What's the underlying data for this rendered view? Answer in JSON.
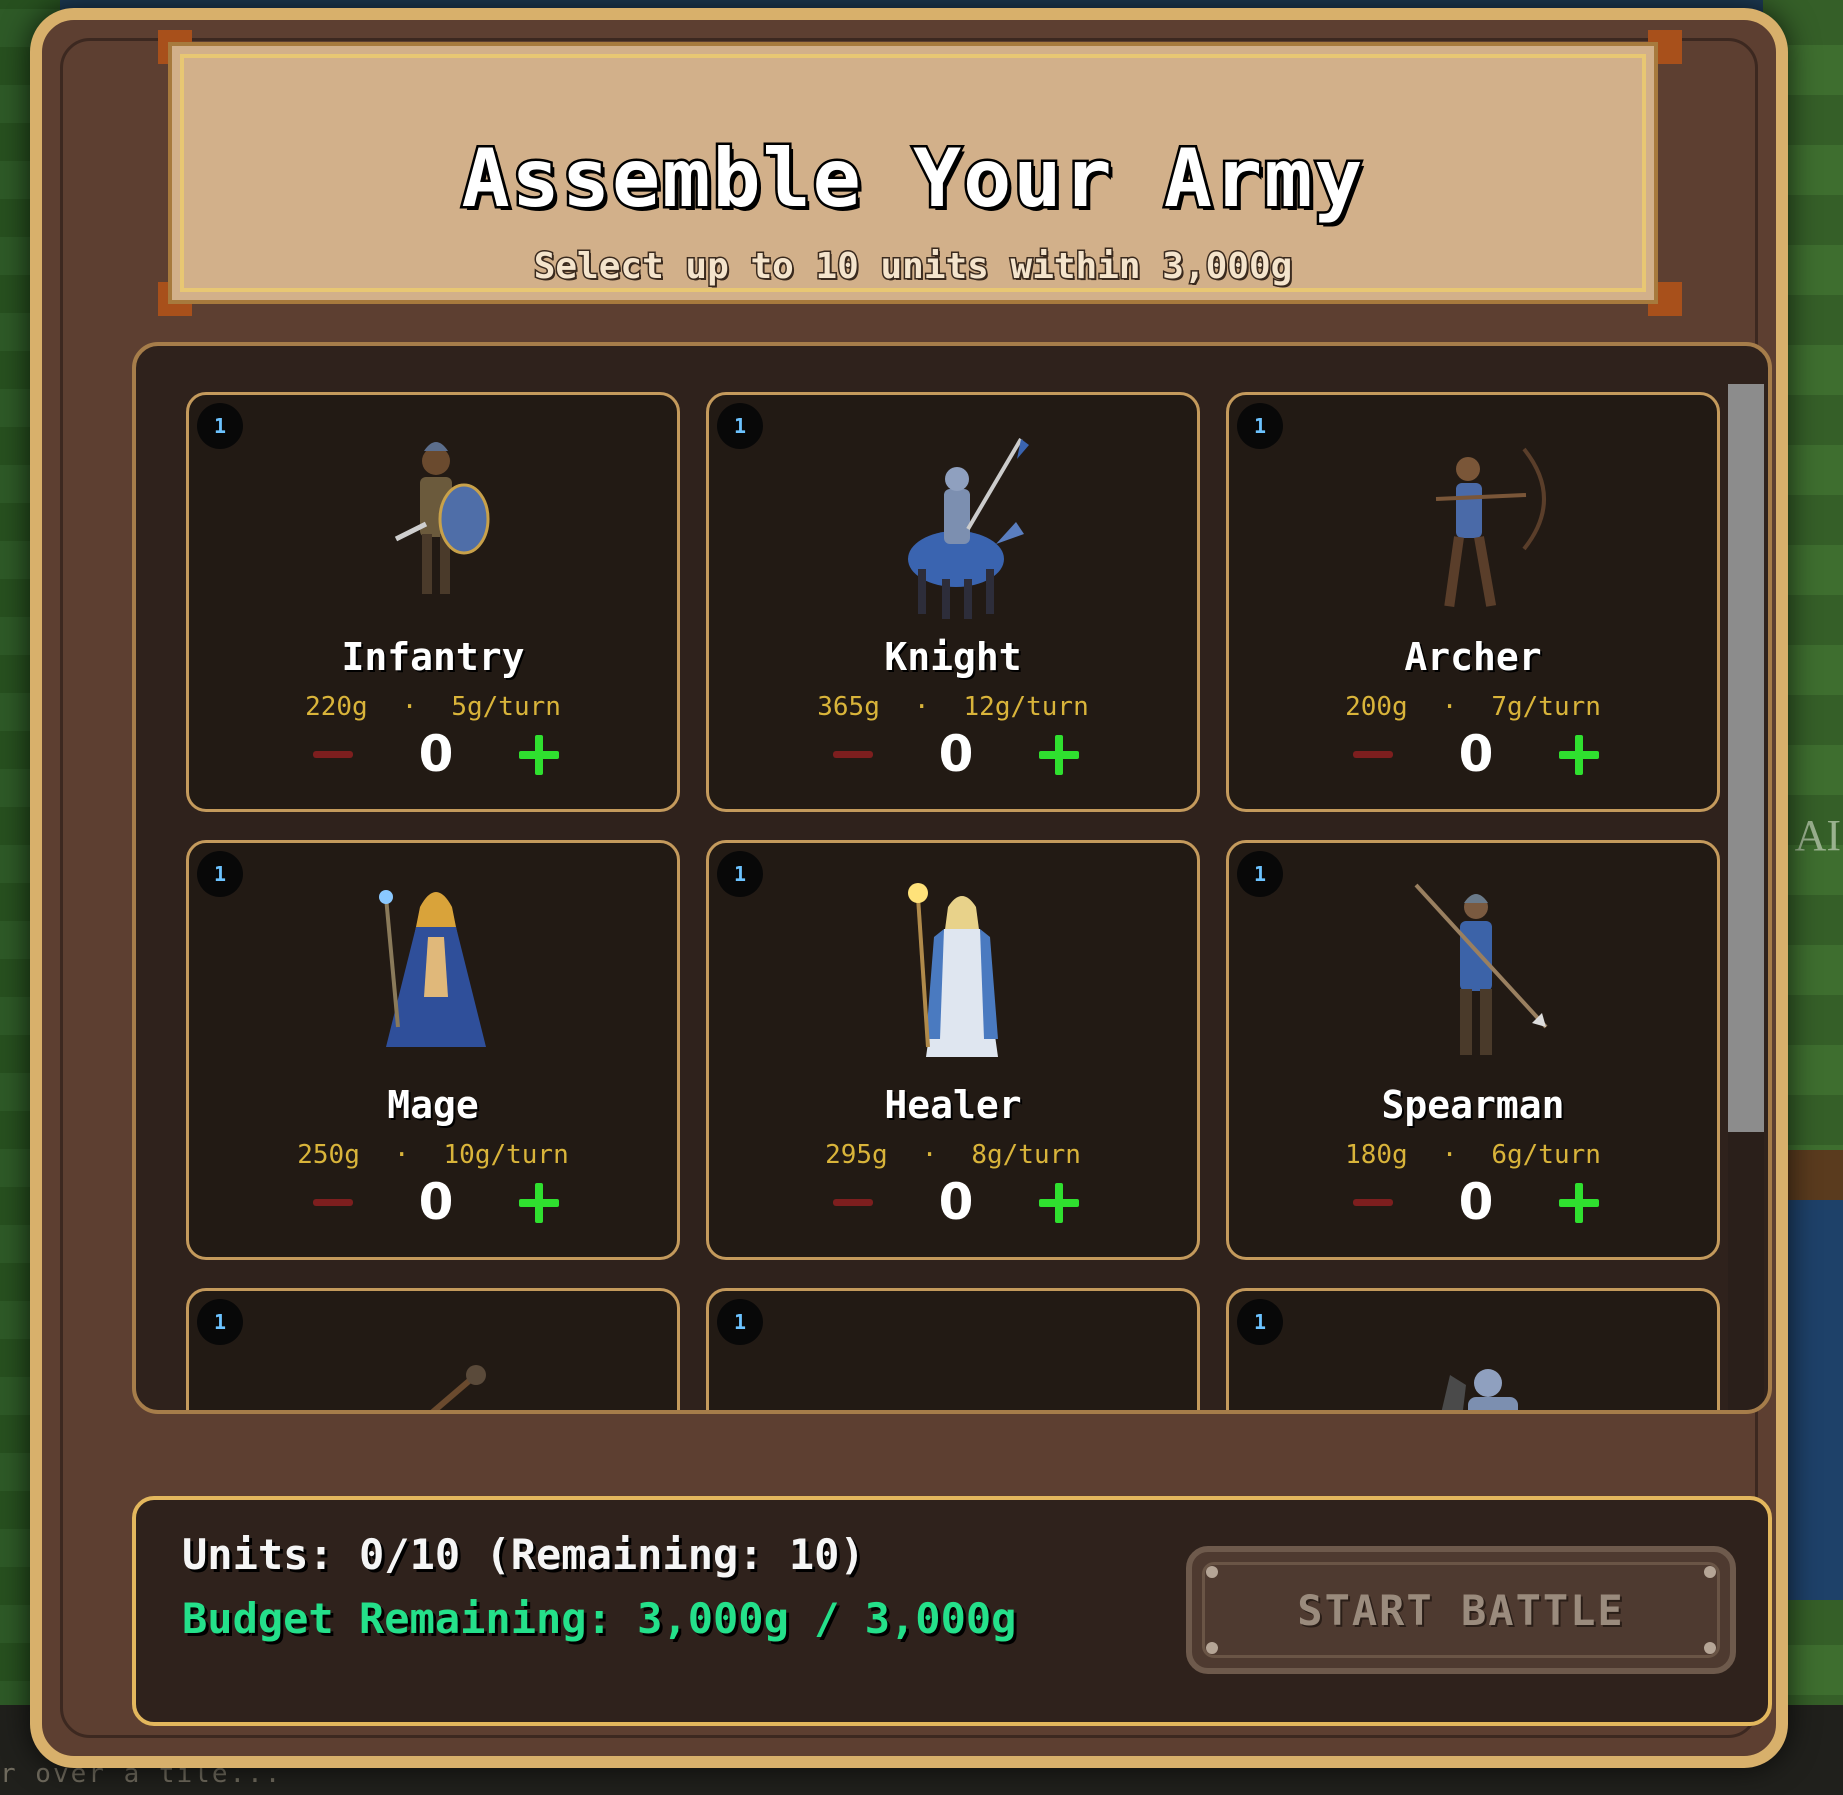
{
  "background": {
    "hint_text": "r over a tile...",
    "side_label": "AI"
  },
  "header": {
    "title": "Assemble Your Army",
    "subtitle": "Select up to 10 units within 3,000g"
  },
  "units": [
    {
      "badge": "1",
      "name": "Infantry",
      "cost": "220g",
      "upkeep": "5g/turn",
      "count": "0",
      "icon": "infantry-portrait",
      "color": "#4f6ea8"
    },
    {
      "badge": "1",
      "name": "Knight",
      "cost": "365g",
      "upkeep": "12g/turn",
      "count": "0",
      "icon": "knight-portrait",
      "color": "#3a64b0"
    },
    {
      "badge": "1",
      "name": "Archer",
      "cost": "200g",
      "upkeep": "7g/turn",
      "count": "0",
      "icon": "archer-portrait",
      "color": "#4a6aa8"
    },
    {
      "badge": "1",
      "name": "Mage",
      "cost": "250g",
      "upkeep": "10g/turn",
      "count": "0",
      "icon": "mage-portrait",
      "color": "#2f4f9a"
    },
    {
      "badge": "1",
      "name": "Healer",
      "cost": "295g",
      "upkeep": "8g/turn",
      "count": "0",
      "icon": "healer-portrait",
      "color": "#dfe6f0"
    },
    {
      "badge": "1",
      "name": "Spearman",
      "cost": "180g",
      "upkeep": "6g/turn",
      "count": "0",
      "icon": "spearman-portrait",
      "color": "#3c63a8"
    },
    {
      "badge": "1",
      "icon": "catapult-portrait"
    },
    {
      "badge": "1",
      "icon": "scout-portrait"
    },
    {
      "badge": "1",
      "icon": "cavalry-portrait"
    }
  ],
  "footer": {
    "units_text": "Units: 0/10 (Remaining: 10)",
    "budget_text": "Budget Remaining: 3,000g / 3,000g",
    "start_label": "START BATTLE"
  },
  "controls": {
    "minus_symbol": "−",
    "plus_symbol": "+",
    "separator": "·"
  },
  "colors": {
    "accent_gold": "#d8b06b",
    "budget_green": "#24e08a",
    "plus_green": "#2fe02f",
    "minus_red": "#7d1e1e",
    "cost_yellow": "#d9b43a"
  }
}
